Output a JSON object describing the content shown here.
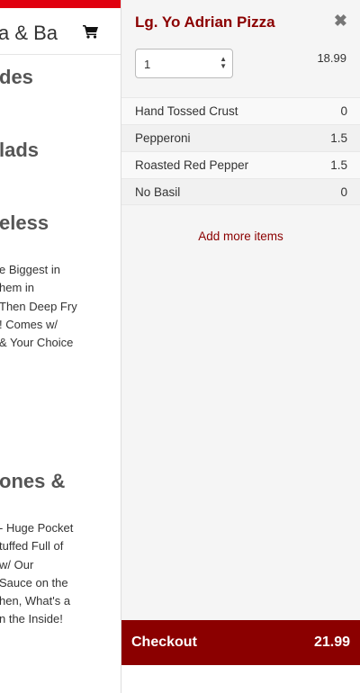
{
  "left_page": {
    "brand": "a & Ba",
    "sections": [
      {
        "heading": "des"
      },
      {
        "heading": "lads"
      },
      {
        "heading": "eless"
      },
      {
        "heading": "ones &"
      }
    ],
    "desc1": [
      "e Biggest in",
      "hem in",
      "Then Deep Fry",
      "! Comes w/",
      "& Your Choice"
    ],
    "desc2": [
      "- Huge Pocket",
      "tuffed Full of",
      "w/ Our",
      "Sauce on the",
      "hen, What's a",
      "n the Inside!"
    ]
  },
  "panel": {
    "item_title": "Lg. Yo Adrian Pizza",
    "close_glyph": "✖",
    "quantity": "1",
    "price": "18.99",
    "options": [
      {
        "name": "Hand Tossed Crust",
        "price": "0"
      },
      {
        "name": "Pepperoni",
        "price": "1.5"
      },
      {
        "name": "Roasted Red Pepper",
        "price": "1.5"
      },
      {
        "name": "No Basil",
        "price": "0"
      }
    ],
    "add_more_label": "Add more items",
    "checkout_label": "Checkout",
    "checkout_total": "21.99"
  },
  "colors": {
    "accent": "#8b0000",
    "header_bar": "#e0000f"
  }
}
